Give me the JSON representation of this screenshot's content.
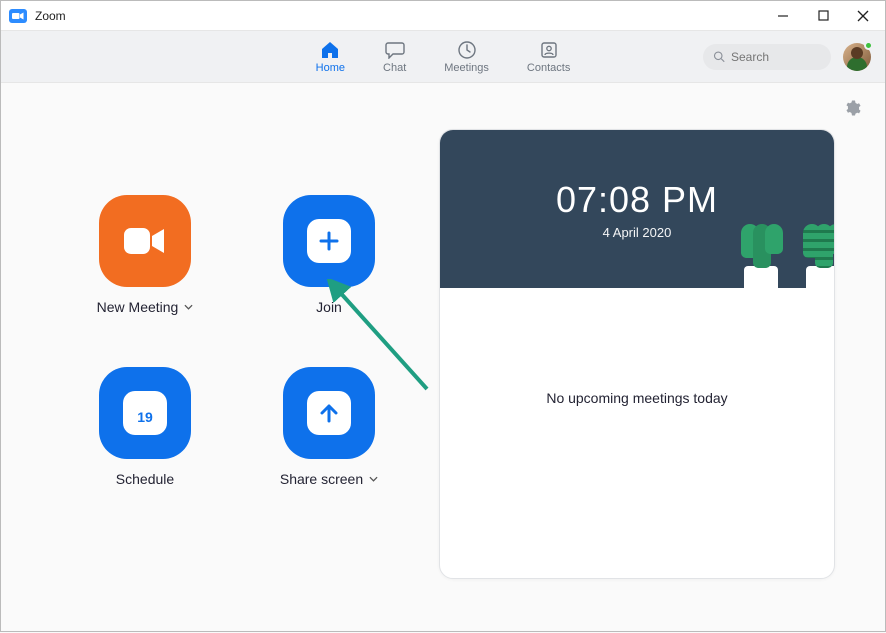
{
  "window": {
    "title": "Zoom"
  },
  "nav": {
    "home": "Home",
    "chat": "Chat",
    "meetings": "Meetings",
    "contacts": "Contacts"
  },
  "search": {
    "placeholder": "Search"
  },
  "actions": {
    "new_meeting": "New Meeting",
    "join": "Join",
    "schedule": "Schedule",
    "schedule_day": "19",
    "share_screen": "Share screen"
  },
  "panel": {
    "time": "07:08 PM",
    "date": "4 April 2020",
    "empty": "No upcoming meetings today"
  }
}
